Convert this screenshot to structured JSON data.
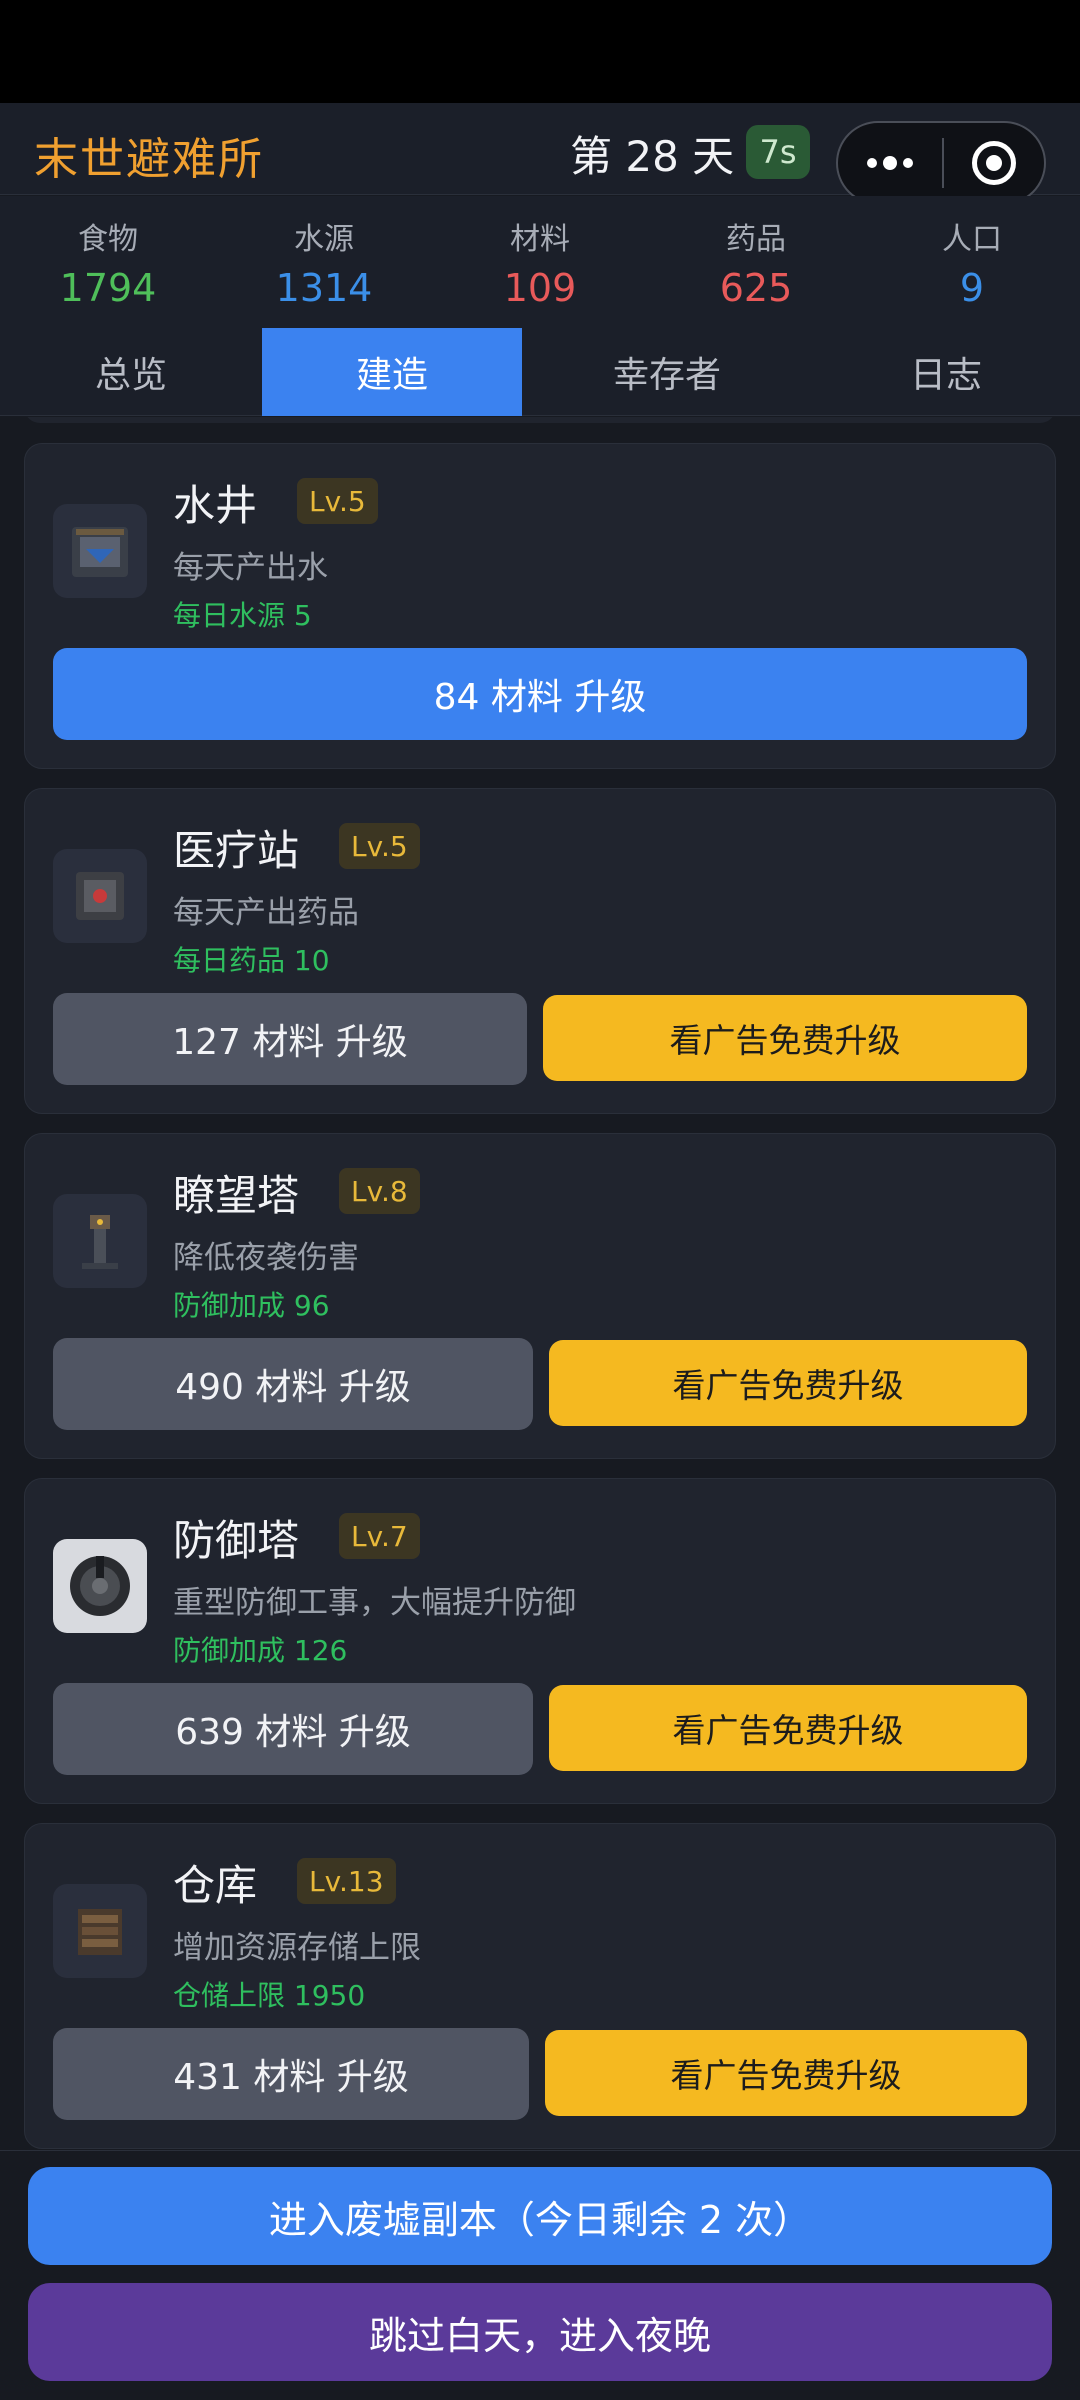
{
  "header": {
    "app_title": "末世避难所",
    "day_label": "第 28 天",
    "timer": "7s"
  },
  "resources": [
    {
      "label": "食物",
      "value": "1794",
      "color": "#4fbf5a"
    },
    {
      "label": "水源",
      "value": "1314",
      "color": "#3b8fe8"
    },
    {
      "label": "材料",
      "value": "109",
      "color": "#e85a5a"
    },
    {
      "label": "药品",
      "value": "625",
      "color": "#e85a5a"
    },
    {
      "label": "人口",
      "value": "9",
      "color": "#3b8fe8"
    }
  ],
  "tabs": [
    {
      "label": "总览"
    },
    {
      "label": "建造"
    },
    {
      "label": "幸存者"
    },
    {
      "label": "日志"
    }
  ],
  "buildings": [
    {
      "name": "水井",
      "level": "Lv.5",
      "desc": "每天产出水",
      "effect": "每日水源 5",
      "upgrade_label": "84 材料 升级",
      "icon": "well-icon"
    },
    {
      "name": "医疗站",
      "level": "Lv.5",
      "desc": "每天产出药品",
      "effect": "每日药品 10",
      "upgrade_label": "127 材料 升级",
      "ad_label": "看广告免费升级",
      "icon": "medical-station-icon"
    },
    {
      "name": "瞭望塔",
      "level": "Lv.8",
      "desc": "降低夜袭伤害",
      "effect": "防御加成 96",
      "upgrade_label": "490 材料 升级",
      "ad_label": "看广告免费升级",
      "icon": "watchtower-icon"
    },
    {
      "name": "防御塔",
      "level": "Lv.7",
      "desc": "重型防御工事，大幅提升防御",
      "effect": "防御加成 126",
      "upgrade_label": "639 材料 升级",
      "ad_label": "看广告免费升级",
      "icon": "defense-tower-icon"
    },
    {
      "name": "仓库",
      "level": "Lv.13",
      "desc": "增加资源存储上限",
      "effect": "仓储上限 1950",
      "upgrade_label": "431 材料 升级",
      "ad_label": "看广告免费升级",
      "icon": "warehouse-icon"
    }
  ],
  "actions": {
    "enter_ruins": "进入废墟副本（今日剩余 2 次）",
    "skip_day": "跳过白天，进入夜晚"
  },
  "colors": {
    "accent_blue": "#3b82f0",
    "ad_yellow": "#f5b920",
    "night_purple": "#5b3a9a",
    "title_orange": "#f0a030",
    "effect_green": "#2fbf5f"
  }
}
